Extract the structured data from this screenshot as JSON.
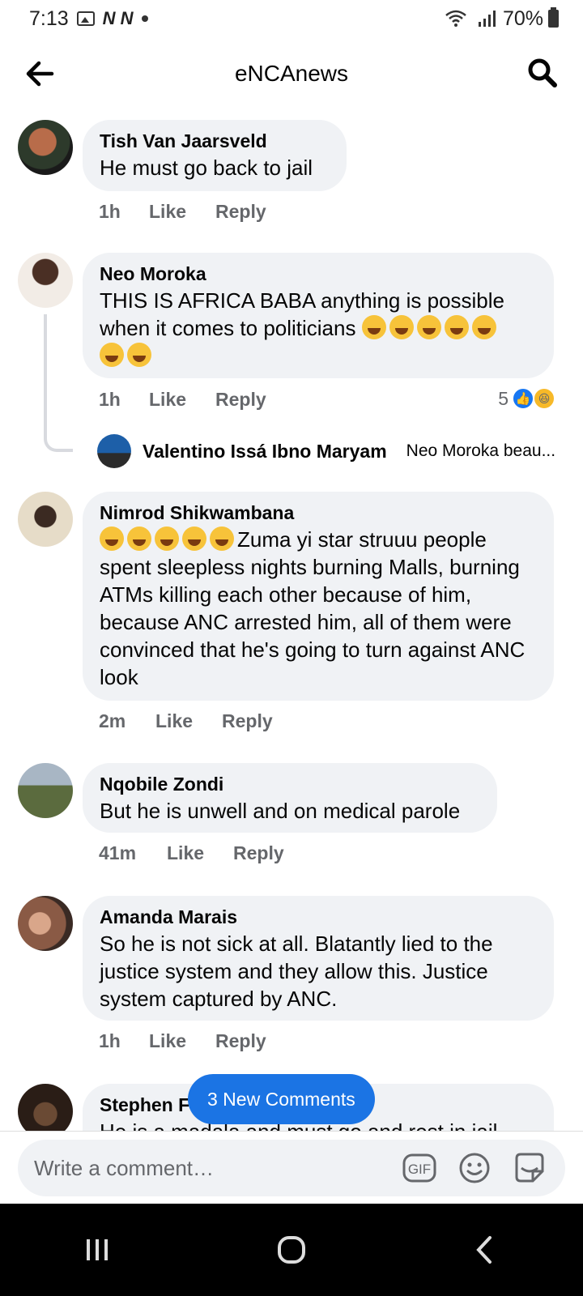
{
  "status_bar": {
    "time": "7:13",
    "network_letters": "N N",
    "battery_percent": "70%"
  },
  "header": {
    "title": "eNCAnews"
  },
  "comments": [
    {
      "author": "Tish Van Jaarsveld",
      "text": "He must go back to jail",
      "time": "1h",
      "like": "Like",
      "reply": "Reply"
    },
    {
      "author": "Neo Moroka",
      "text": "THIS IS AFRICA BABA anything is possible when it comes to politicians",
      "time": "1h",
      "like": "Like",
      "reply": "Reply",
      "reaction_count": "5",
      "reply_preview": {
        "author": "Valentino Issá Ibno Maryam",
        "text": "Neo Moroka beau..."
      }
    },
    {
      "author": "Nimrod Shikwambana",
      "text": "Zuma yi star struuu people spent sleepless nights burning Malls, burning ATMs killing each other because of him, because ANC arrested him, all of them were convinced that he's going to turn against ANC look",
      "time": "2m",
      "like": "Like",
      "reply": "Reply"
    },
    {
      "author": "Nqobile Zondi",
      "text": "But he is unwell and on medical parole",
      "time": "41m",
      "like": "Like",
      "reply": "Reply"
    },
    {
      "author": "Amanda Marais",
      "text": "So he is not sick at all. Blatantly lied to the justice system and they allow this. Justice system captured by ANC.",
      "time": "1h",
      "like": "Like",
      "reply": "Reply"
    },
    {
      "author": "Stephen F",
      "text": "He is a madala and must go and rest in jail"
    }
  ],
  "new_comments_label": "3 New Comments",
  "composer": {
    "placeholder": "Write a comment…",
    "gif_label": "GIF"
  },
  "colors": {
    "accent": "#1b74e4",
    "bubble": "#f0f2f5",
    "meta": "#65676b"
  },
  "icons": [
    "back-arrow-icon",
    "search-icon",
    "gif-icon",
    "emoji-icon",
    "sticker-icon",
    "recents-icon",
    "home-icon",
    "back-nav-icon"
  ]
}
